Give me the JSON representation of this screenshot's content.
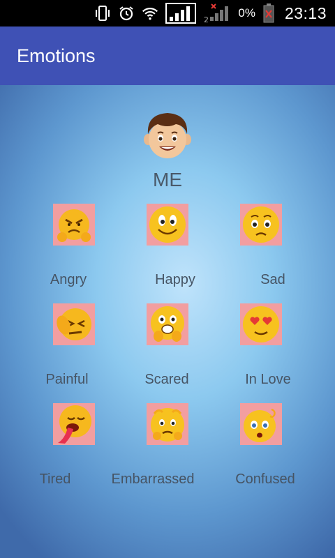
{
  "status_bar": {
    "icons": [
      "vibrate-icon",
      "alarm-icon",
      "wifi-icon",
      "signal-sim1-icon",
      "signal-sim2-icon",
      "battery-icon"
    ],
    "battery_percent": "0%",
    "time": "23:13"
  },
  "app_bar": {
    "title": "Emotions"
  },
  "profile": {
    "label": "ME",
    "icon": "boy-face-icon"
  },
  "emotions": [
    {
      "label": "Angry",
      "icon": "angry-face-icon"
    },
    {
      "label": "Happy",
      "icon": "happy-face-icon"
    },
    {
      "label": "Sad",
      "icon": "sad-face-icon"
    },
    {
      "label": "Painful",
      "icon": "painful-face-icon"
    },
    {
      "label": "Scared",
      "icon": "scared-face-icon"
    },
    {
      "label": "In Love",
      "icon": "in-love-face-icon"
    },
    {
      "label": "Tired",
      "icon": "tired-face-icon"
    },
    {
      "label": "Embarrassed",
      "icon": "embarrassed-face-icon"
    },
    {
      "label": "Confused",
      "icon": "confused-face-icon"
    }
  ],
  "colors": {
    "app_bar": "#3f51b5",
    "tile_background": "#f29ea0",
    "label_text": "#465464"
  }
}
